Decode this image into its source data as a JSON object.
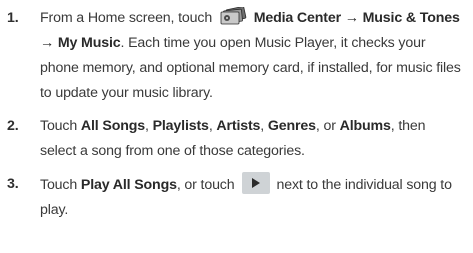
{
  "icons": {
    "media": "media-center-icon",
    "play": "play-icon"
  },
  "colors": {
    "text": "#3a3a3a",
    "play_button_bg": "#cfd3d6"
  },
  "steps": [
    {
      "number": "1.",
      "t1": "From a Home screen, touch ",
      "b1": "Media Center → Music & Tones → My Music",
      "t2": ". Each time you open Music Player, it checks your phone memory, and optional memory card, if installed, for music files to update your music library."
    },
    {
      "number": "2.",
      "t1": "Touch ",
      "b1": "All Songs",
      "t2": ", ",
      "b2": "Playlists",
      "t3": ", ",
      "b3": "Artists",
      "t4": ", ",
      "b4": "Genres",
      "t5": ", or ",
      "b5": "Albums",
      "t6": ", then select a song from one of those categories."
    },
    {
      "number": "3.",
      "t1": "Touch ",
      "b1": "Play All Songs",
      "t2": ", or touch",
      "t3": "next to the individual song to play."
    }
  ]
}
